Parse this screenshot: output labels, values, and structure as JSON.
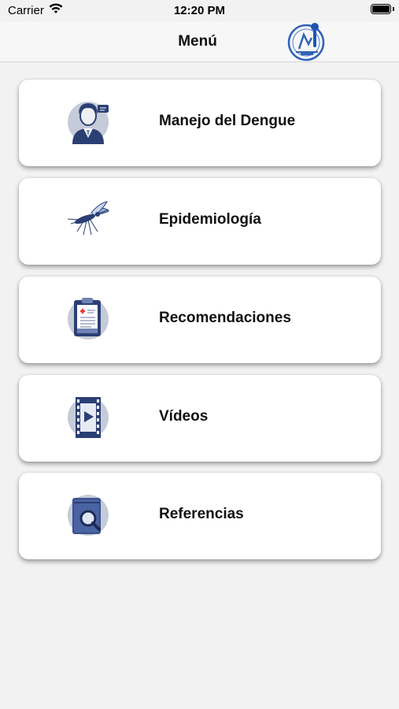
{
  "status_bar": {
    "carrier": "Carrier",
    "time": "12:20 PM"
  },
  "nav": {
    "title": "Menú",
    "logo_icon": "institution-logo-icon"
  },
  "menu": {
    "items": [
      {
        "label": "Manejo del Dengue",
        "icon": "doctor-icon"
      },
      {
        "label": "Epidemiología",
        "icon": "mosquito-icon"
      },
      {
        "label": "Recomendaciones",
        "icon": "clipboard-icon"
      },
      {
        "label": "Vídeos",
        "icon": "film-play-icon"
      },
      {
        "label": "Referencias",
        "icon": "book-search-icon"
      }
    ]
  },
  "colors": {
    "icon_navy": "#2b3f73",
    "icon_light": "#6f84b5",
    "card_bg": "#ffffff",
    "page_bg": "#f2f2f2"
  }
}
